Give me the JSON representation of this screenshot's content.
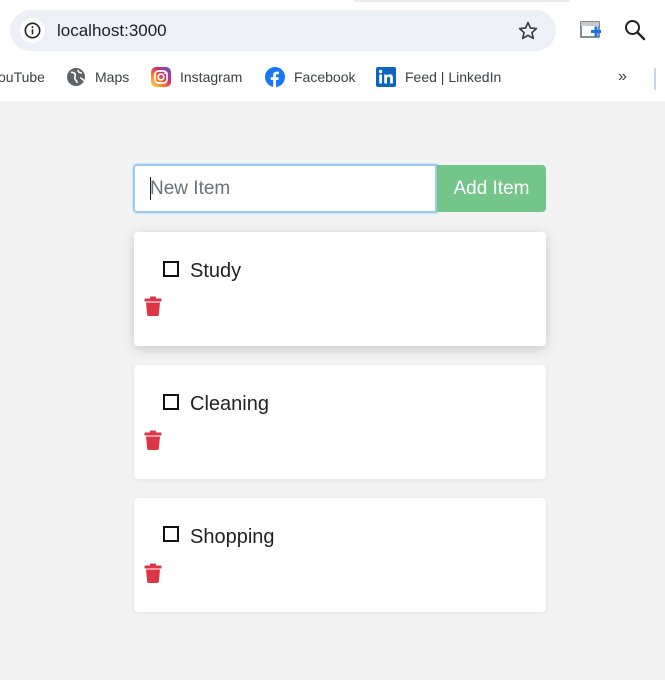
{
  "browser": {
    "url": "localhost:3000",
    "bookmarks": [
      {
        "label": "ouTube",
        "icon": "youtube-icon"
      },
      {
        "label": "Maps",
        "icon": "maps-globe-icon"
      },
      {
        "label": "Instagram",
        "icon": "instagram-icon"
      },
      {
        "label": "Facebook",
        "icon": "facebook-icon"
      },
      {
        "label": "Feed | LinkedIn",
        "icon": "linkedin-icon"
      }
    ],
    "more_label": "»"
  },
  "app": {
    "input": {
      "placeholder": "New Item",
      "value": ""
    },
    "add_button_label": "Add Item",
    "items": [
      {
        "label": "Study",
        "checked": false
      },
      {
        "label": "Cleaning",
        "checked": false
      },
      {
        "label": "Shopping",
        "checked": false
      }
    ]
  },
  "colors": {
    "add_button": "#74c58a",
    "delete_icon": "#dc3545",
    "page_background": "#f3f3f3"
  }
}
